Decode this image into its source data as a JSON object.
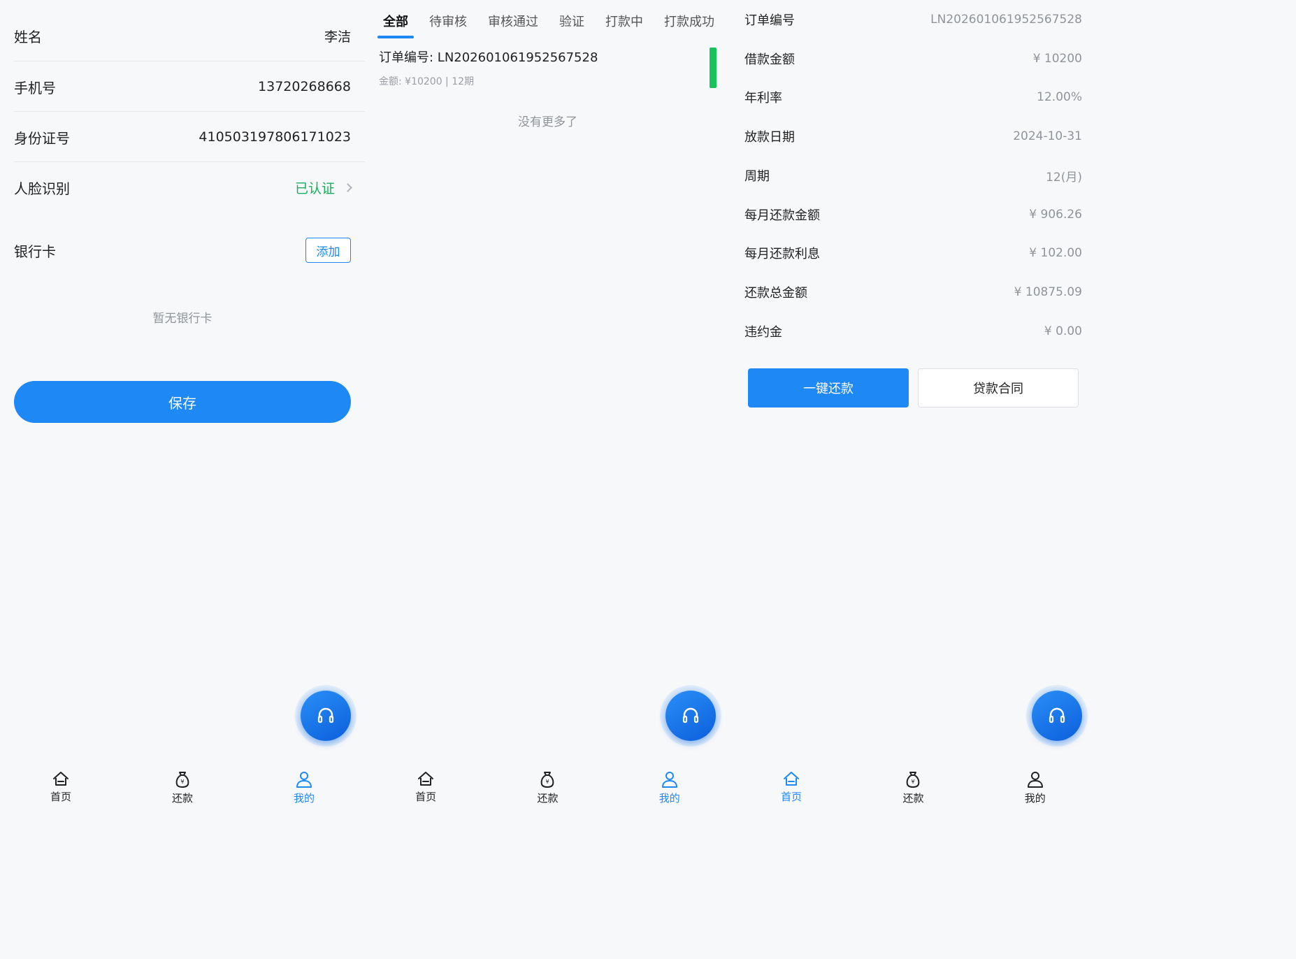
{
  "profile": {
    "name_label": "姓名",
    "name_value": "李洁",
    "phone_label": "手机号",
    "phone_value": "13720268668",
    "id_label": "身份证号",
    "id_value": "410503197806171023",
    "face_label": "人脸识别",
    "face_status": "已认证",
    "bank_label": "银行卡",
    "add_button": "添加",
    "empty_bank": "暂无银行卡",
    "save_button": "保存"
  },
  "orders": {
    "tabs": [
      "全部",
      "待审核",
      "审核通过",
      "验证",
      "打款中",
      "打款成功"
    ],
    "active_tab": 0,
    "item": {
      "order_no": "订单编号: LN202601061952567528",
      "meta": "金额: ¥10200 | 12期",
      "status_color": "#19c25a"
    },
    "no_more": "没有更多了"
  },
  "detail": {
    "rows": [
      {
        "label": "订单编号",
        "value": "LN202601061952567528"
      },
      {
        "label": "借款金额",
        "value": "¥ 10200"
      },
      {
        "label": "年利率",
        "value": "12.00%"
      },
      {
        "label": "放款日期",
        "value": "2024-10-31"
      },
      {
        "label": "周期",
        "value": "12(月)"
      },
      {
        "label": "每月还款金额",
        "value": "¥ 906.26"
      },
      {
        "label": "每月还款利息",
        "value": "¥ 102.00"
      },
      {
        "label": "还款总金额",
        "value": "¥ 10875.09"
      },
      {
        "label": "违约金",
        "value": "¥ 0.00"
      }
    ],
    "repay_button": "一键还款",
    "contract_button": "贷款合同"
  },
  "nav": {
    "home": "首页",
    "repay": "还款",
    "mine": "我的"
  },
  "nav_active": {
    "panel1": "mine",
    "panel2": "mine",
    "panel3": "home"
  },
  "colors": {
    "accent": "#1e88f5",
    "verified": "#1aad5c",
    "status_bar": "#19c25a",
    "background": "#f7f8fa"
  },
  "icons": [
    "headset-icon",
    "home-icon",
    "money-bag-icon",
    "user-icon",
    "chevron-right-icon"
  ]
}
